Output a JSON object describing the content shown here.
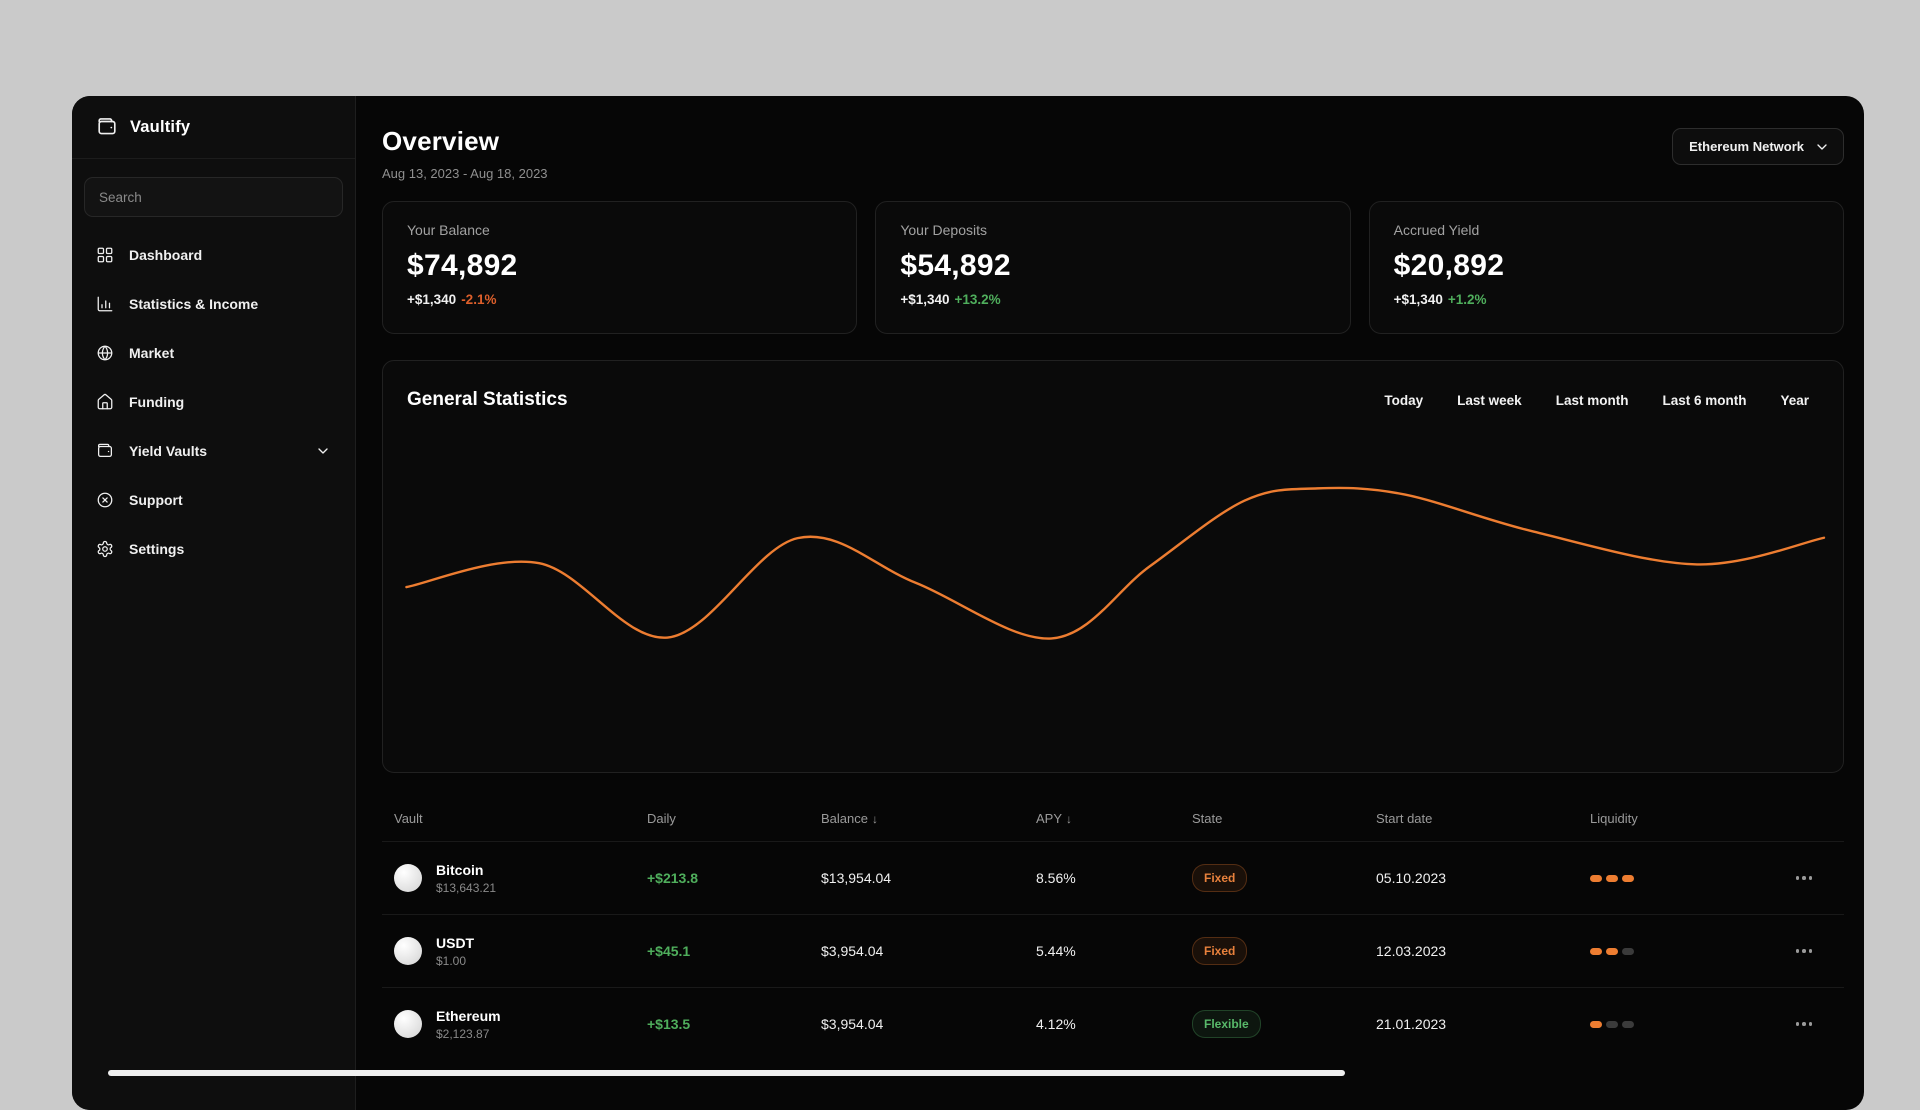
{
  "app": {
    "name": "Vaultify"
  },
  "sidebar": {
    "search_placeholder": "Search",
    "items": [
      {
        "label": "Dashboard",
        "icon": "dashboard-grid-icon"
      },
      {
        "label": "Statistics & Income",
        "icon": "statistics-chart-icon"
      },
      {
        "label": "Market",
        "icon": "globe-icon"
      },
      {
        "label": "Funding",
        "icon": "home-icon"
      },
      {
        "label": "Yield Vaults",
        "icon": "wallet-icon",
        "expandable": true
      },
      {
        "label": "Support",
        "icon": "support-icon"
      },
      {
        "label": "Settings",
        "icon": "gear-icon"
      }
    ]
  },
  "header": {
    "title": "Overview",
    "date_range": "Aug 13, 2023 - Aug 18, 2023",
    "network_selector_label": "Ethereum Network"
  },
  "stat_cards": [
    {
      "label": "Your Balance",
      "value": "$74,892",
      "change_amount": "+$1,340",
      "change_percent": "-2.1%",
      "percent_color": "#dd5f2b"
    },
    {
      "label": "Your Deposits",
      "value": "$54,892",
      "change_amount": "+$1,340",
      "change_percent": "+13.2%",
      "percent_color": "#4fae5c"
    },
    {
      "label": "Accrued Yield",
      "value": "$20,892",
      "change_amount": "+$1,340",
      "change_percent": "+1.2%",
      "percent_color": "#4fae5c"
    }
  ],
  "statistics_panel": {
    "title": "General Statistics",
    "filters": [
      "Today",
      "Last week",
      "Last month",
      "Last 6 month",
      "Year"
    ]
  },
  "chart_data": {
    "type": "line",
    "title": "General Statistics",
    "x_range_label": "Aug 13, 2023 - Aug 18, 2023",
    "axes_visible": false,
    "grid": false,
    "legend": false,
    "value_scale": "relative 0-100 (estimated from unlabeled sparkline)",
    "series": [
      {
        "name": "portfolio-value",
        "color": "#ed7d31",
        "points": [
          [
            1.6,
            45.0
          ],
          [
            10.7,
            50.8
          ],
          [
            19.5,
            32.7
          ],
          [
            28.4,
            56.9
          ],
          [
            36.5,
            46.0
          ],
          [
            45.8,
            32.5
          ],
          [
            52.5,
            50.0
          ],
          [
            59.0,
            66.0
          ],
          [
            64.0,
            69.0
          ],
          [
            70.0,
            67.5
          ],
          [
            78.8,
            58.5
          ],
          [
            90.0,
            50.5
          ],
          [
            98.7,
            57.0
          ]
        ]
      }
    ]
  },
  "vault_table": {
    "columns": [
      {
        "label": "Vault"
      },
      {
        "label": "Daily"
      },
      {
        "label": "Balance",
        "sort_indicator": "↓"
      },
      {
        "label": "APY",
        "sort_indicator": "↓"
      },
      {
        "label": "State"
      },
      {
        "label": "Start date"
      },
      {
        "label": "Liquidity"
      },
      {
        "label": ""
      }
    ],
    "rows": [
      {
        "name": "Bitcoin",
        "price": "$13,643.21",
        "daily_change": "+$213.8",
        "balance": "$13,954.04",
        "apy": "8.56%",
        "state": "Fixed",
        "state_type": "fixed",
        "start_date": "05.10.2023",
        "liquidity_level": 3,
        "liquidity_max": 3
      },
      {
        "name": "USDT",
        "price": "$1.00",
        "daily_change": "+$45.1",
        "balance": "$3,954.04",
        "apy": "5.44%",
        "state": "Fixed",
        "state_type": "fixed",
        "start_date": "12.03.2023",
        "liquidity_level": 2,
        "liquidity_max": 3
      },
      {
        "name": "Ethereum",
        "price": "$2,123.87",
        "daily_change": "+$13.5",
        "balance": "$3,954.04",
        "apy": "4.12%",
        "state": "Flexible",
        "state_type": "flexible",
        "start_date": "21.01.2023",
        "liquidity_level": 1,
        "liquidity_max": 3
      }
    ]
  },
  "colors": {
    "accent_orange": "#ed7d31",
    "positive_green": "#4fae5c",
    "negative_orange_red": "#dd5f2b",
    "liquidity_off": "#3a3a3a"
  }
}
